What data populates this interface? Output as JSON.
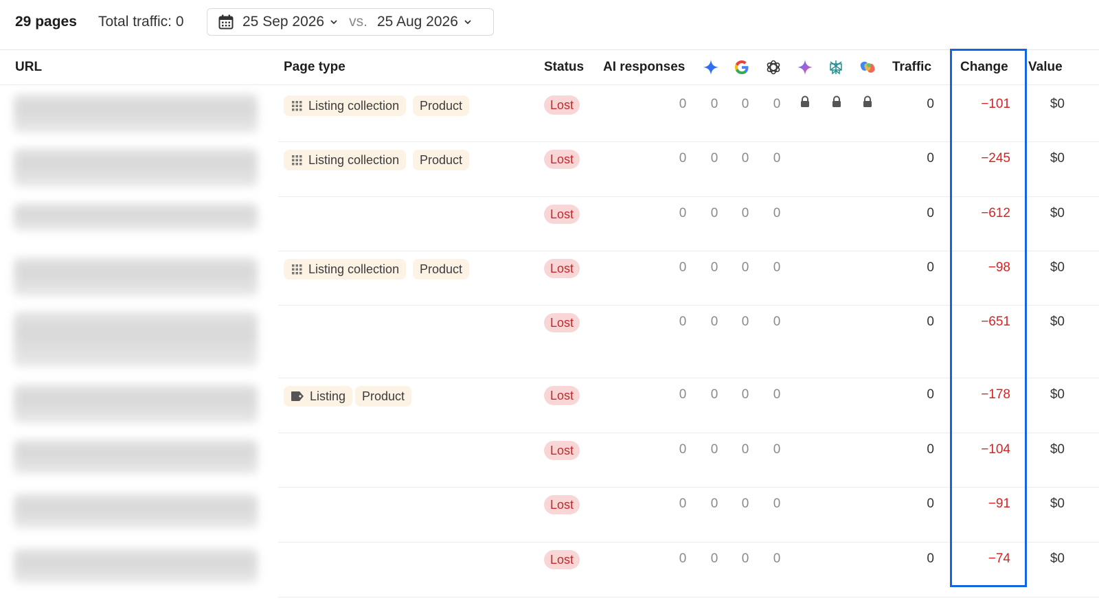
{
  "summary": {
    "pages_count": "29 pages",
    "total_traffic": "Total traffic: 0"
  },
  "date_range": {
    "current": "25 Sep 2026",
    "separator": "vs.",
    "compare": "25 Aug 2026"
  },
  "columns": {
    "url": "URL",
    "page_type": "Page type",
    "status": "Status",
    "ai_responses": "AI responses",
    "ai_icons": [
      "gemini-icon",
      "google-icon",
      "chatgpt-icon",
      "gemini-alt-icon",
      "perplexity-icon",
      "copilot-icon"
    ],
    "traffic": "Traffic",
    "change": "Change",
    "value": "Value"
  },
  "colors": {
    "lost_text": "#c02a2a",
    "lost_bg": "#f8d6d6",
    "change_negative": "#d42424",
    "highlight": "#1465e0",
    "tag_bg": "#fdf3e4"
  },
  "rows": [
    {
      "tags": [
        {
          "icon": "grid-icon",
          "label": "Listing collection"
        },
        {
          "label": "Product"
        }
      ],
      "status": "Lost",
      "ai": [
        "0",
        "0",
        "0",
        "0"
      ],
      "locked": true,
      "traffic": "0",
      "change": "−101",
      "value": "$0"
    },
    {
      "tags": [
        {
          "icon": "grid-icon",
          "label": "Listing collection"
        },
        {
          "label": "Product"
        }
      ],
      "status": "Lost",
      "ai": [
        "0",
        "0",
        "0",
        "0"
      ],
      "locked": false,
      "traffic": "0",
      "change": "−245",
      "value": "$0"
    },
    {
      "tags": [],
      "status": "Lost",
      "ai": [
        "0",
        "0",
        "0",
        "0"
      ],
      "locked": false,
      "traffic": "0",
      "change": "−612",
      "value": "$0"
    },
    {
      "tags": [
        {
          "icon": "grid-icon",
          "label": "Listing collection"
        },
        {
          "label": "Product"
        }
      ],
      "status": "Lost",
      "ai": [
        "0",
        "0",
        "0",
        "0"
      ],
      "locked": false,
      "traffic": "0",
      "change": "−98",
      "value": "$0"
    },
    {
      "tags": [],
      "status": "Lost",
      "ai": [
        "0",
        "0",
        "0",
        "0"
      ],
      "locked": false,
      "traffic": "0",
      "change": "−651",
      "value": "$0"
    },
    {
      "tags": [
        {
          "icon": "tag-icon",
          "label": "Listing"
        },
        {
          "label": "Product"
        }
      ],
      "status": "Lost",
      "ai": [
        "0",
        "0",
        "0",
        "0"
      ],
      "locked": false,
      "traffic": "0",
      "change": "−178",
      "value": "$0"
    },
    {
      "tags": [],
      "status": "Lost",
      "ai": [
        "0",
        "0",
        "0",
        "0"
      ],
      "locked": false,
      "traffic": "0",
      "change": "−104",
      "value": "$0"
    },
    {
      "tags": [],
      "status": "Lost",
      "ai": [
        "0",
        "0",
        "0",
        "0"
      ],
      "locked": false,
      "traffic": "0",
      "change": "−91",
      "value": "$0"
    },
    {
      "tags": [],
      "status": "Lost",
      "ai": [
        "0",
        "0",
        "0",
        "0"
      ],
      "locked": false,
      "traffic": "0",
      "change": "−74",
      "value": "$0"
    }
  ]
}
